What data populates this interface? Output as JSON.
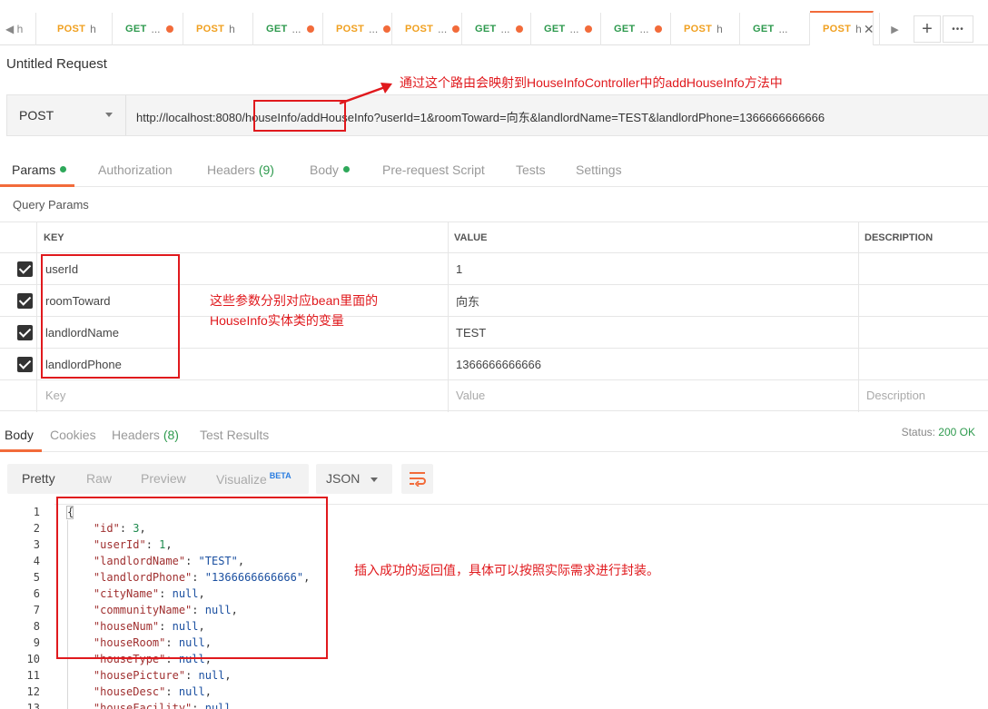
{
  "tabs": [
    {
      "method": "POST",
      "title": "h",
      "dot": false,
      "active": false
    },
    {
      "method": "GET",
      "title": "...",
      "dot": true,
      "active": false
    },
    {
      "method": "POST",
      "title": "h",
      "dot": false,
      "active": false
    },
    {
      "method": "GET",
      "title": "...",
      "dot": true,
      "active": false
    },
    {
      "method": "POST",
      "title": "...",
      "dot": true,
      "active": false
    },
    {
      "method": "POST",
      "title": "...",
      "dot": true,
      "active": false
    },
    {
      "method": "GET",
      "title": "...",
      "dot": true,
      "active": false
    },
    {
      "method": "GET",
      "title": "...",
      "dot": true,
      "active": false
    },
    {
      "method": "GET",
      "title": "...",
      "dot": true,
      "active": false
    },
    {
      "method": "POST",
      "title": "h",
      "dot": false,
      "active": false
    },
    {
      "method": "GET",
      "title": "...",
      "dot": false,
      "active": false
    },
    {
      "method": "POST",
      "title": "h",
      "dot": false,
      "active": true
    }
  ],
  "tabstrip": {
    "scroll_left_label": "◀ h",
    "scroll_right": "▶",
    "add": "+",
    "more": "•••",
    "close": "✕"
  },
  "request": {
    "title": "Untitled Request",
    "method": "POST",
    "url": "http://localhost:8080/houseInfo/addHouseInfo?userId=1&roomToward=向东&landlordName=TEST&landlordPhone=1366666666666"
  },
  "request_tabs": [
    {
      "label": "Params",
      "count": "",
      "dot": true,
      "active": true
    },
    {
      "label": "Authorization",
      "count": "",
      "dot": false,
      "active": false
    },
    {
      "label": "Headers",
      "count": "(9)",
      "dot": false,
      "active": false
    },
    {
      "label": "Body",
      "count": "",
      "dot": true,
      "active": false
    },
    {
      "label": "Pre-request Script",
      "count": "",
      "dot": false,
      "active": false
    },
    {
      "label": "Tests",
      "count": "",
      "dot": false,
      "active": false
    },
    {
      "label": "Settings",
      "count": "",
      "dot": false,
      "active": false
    }
  ],
  "query_params": {
    "title": "Query Params",
    "headers": {
      "key": "KEY",
      "value": "VALUE",
      "description": "DESCRIPTION"
    },
    "rows": [
      {
        "key": "userId",
        "value": "1",
        "checked": true
      },
      {
        "key": "roomToward",
        "value": "向东",
        "checked": true
      },
      {
        "key": "landlordName",
        "value": "TEST",
        "checked": true
      },
      {
        "key": "landlordPhone",
        "value": "1366666666666",
        "checked": true
      }
    ],
    "placeholders": {
      "key": "Key",
      "value": "Value",
      "description": "Description"
    }
  },
  "response_tabs": [
    {
      "label": "Body",
      "count": "",
      "active": true
    },
    {
      "label": "Cookies",
      "count": "",
      "active": false
    },
    {
      "label": "Headers",
      "count": "(8)",
      "active": false
    },
    {
      "label": "Test Results",
      "count": "",
      "active": false
    }
  ],
  "status": {
    "label": "Status:",
    "value": "200 OK"
  },
  "view_modes": [
    {
      "label": "Pretty",
      "active": true
    },
    {
      "label": "Raw",
      "active": false
    },
    {
      "label": "Preview",
      "active": false
    },
    {
      "label": "Visualize",
      "active": false
    }
  ],
  "beta_label": "BETA",
  "format": "JSON",
  "code_lines": [
    {
      "n": "1",
      "key": "",
      "val": "{",
      "type": "brace"
    },
    {
      "n": "2",
      "key": "\"id\"",
      "val": "3",
      "type": "num"
    },
    {
      "n": "3",
      "key": "\"userId\"",
      "val": "1",
      "type": "num"
    },
    {
      "n": "4",
      "key": "\"landlordName\"",
      "val": "\"TEST\"",
      "type": "str"
    },
    {
      "n": "5",
      "key": "\"landlordPhone\"",
      "val": "\"1366666666666\"",
      "type": "str"
    },
    {
      "n": "6",
      "key": "\"cityName\"",
      "val": "null",
      "type": "null"
    },
    {
      "n": "7",
      "key": "\"communityName\"",
      "val": "null",
      "type": "null"
    },
    {
      "n": "8",
      "key": "\"houseNum\"",
      "val": "null",
      "type": "null"
    },
    {
      "n": "9",
      "key": "\"houseRoom\"",
      "val": "null",
      "type": "null"
    },
    {
      "n": "10",
      "key": "\"houseType\"",
      "val": "null",
      "type": "null"
    },
    {
      "n": "11",
      "key": "\"housePicture\"",
      "val": "null",
      "type": "null"
    },
    {
      "n": "12",
      "key": "\"houseDesc\"",
      "val": "null",
      "type": "null"
    },
    {
      "n": "13",
      "key": "\"houseFacility\"",
      "val": "null",
      "type": "null"
    }
  ],
  "annotations": {
    "route_note": "通过这个路由会映射到HouseInfoController中的addHouseInfo方法中",
    "params_note_line1": "这些参数分别对应bean里面的",
    "params_note_line2": "HouseInfo实体类的变量",
    "response_note": "插入成功的返回值，具体可以按照实际需求进行封装。"
  },
  "colors": {
    "accent": "#f26b3a",
    "annotation": "#e0191d",
    "success": "#2e9a4e"
  }
}
